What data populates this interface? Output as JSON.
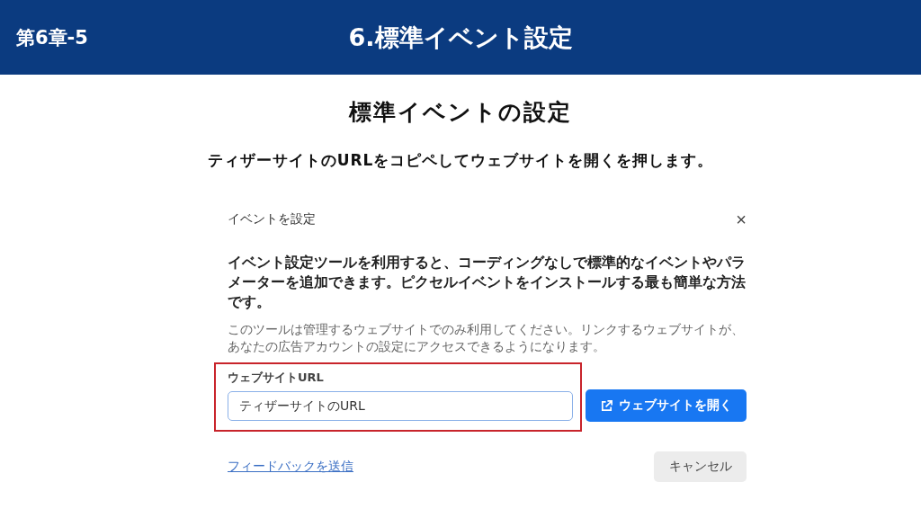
{
  "header": {
    "chapter": "第6章-5",
    "title": "6.標準イベント設定"
  },
  "heading": "標準イベントの設定",
  "instruction": "ティザーサイトのURLをコピペしてウェブサイトを開くを押します。",
  "dialog": {
    "title": "イベントを設定",
    "close": "×",
    "intro": "イベント設定ツールを利用すると、コーディングなしで標準的なイベントやパラメーターを追加できます。ピクセルイベントをインストールする最も簡単な方法です。",
    "note": "このツールは管理するウェブサイトでのみ利用してください。リンクするウェブサイトが、あなたの広告アカウントの設定にアクセスできるようになります。",
    "url_label": "ウェブサイトURL",
    "url_value": "ティザーサイトのURL",
    "open_button": "ウェブサイトを開く",
    "feedback_link": "フィードバックを送信",
    "cancel_button": "キャンセル"
  }
}
